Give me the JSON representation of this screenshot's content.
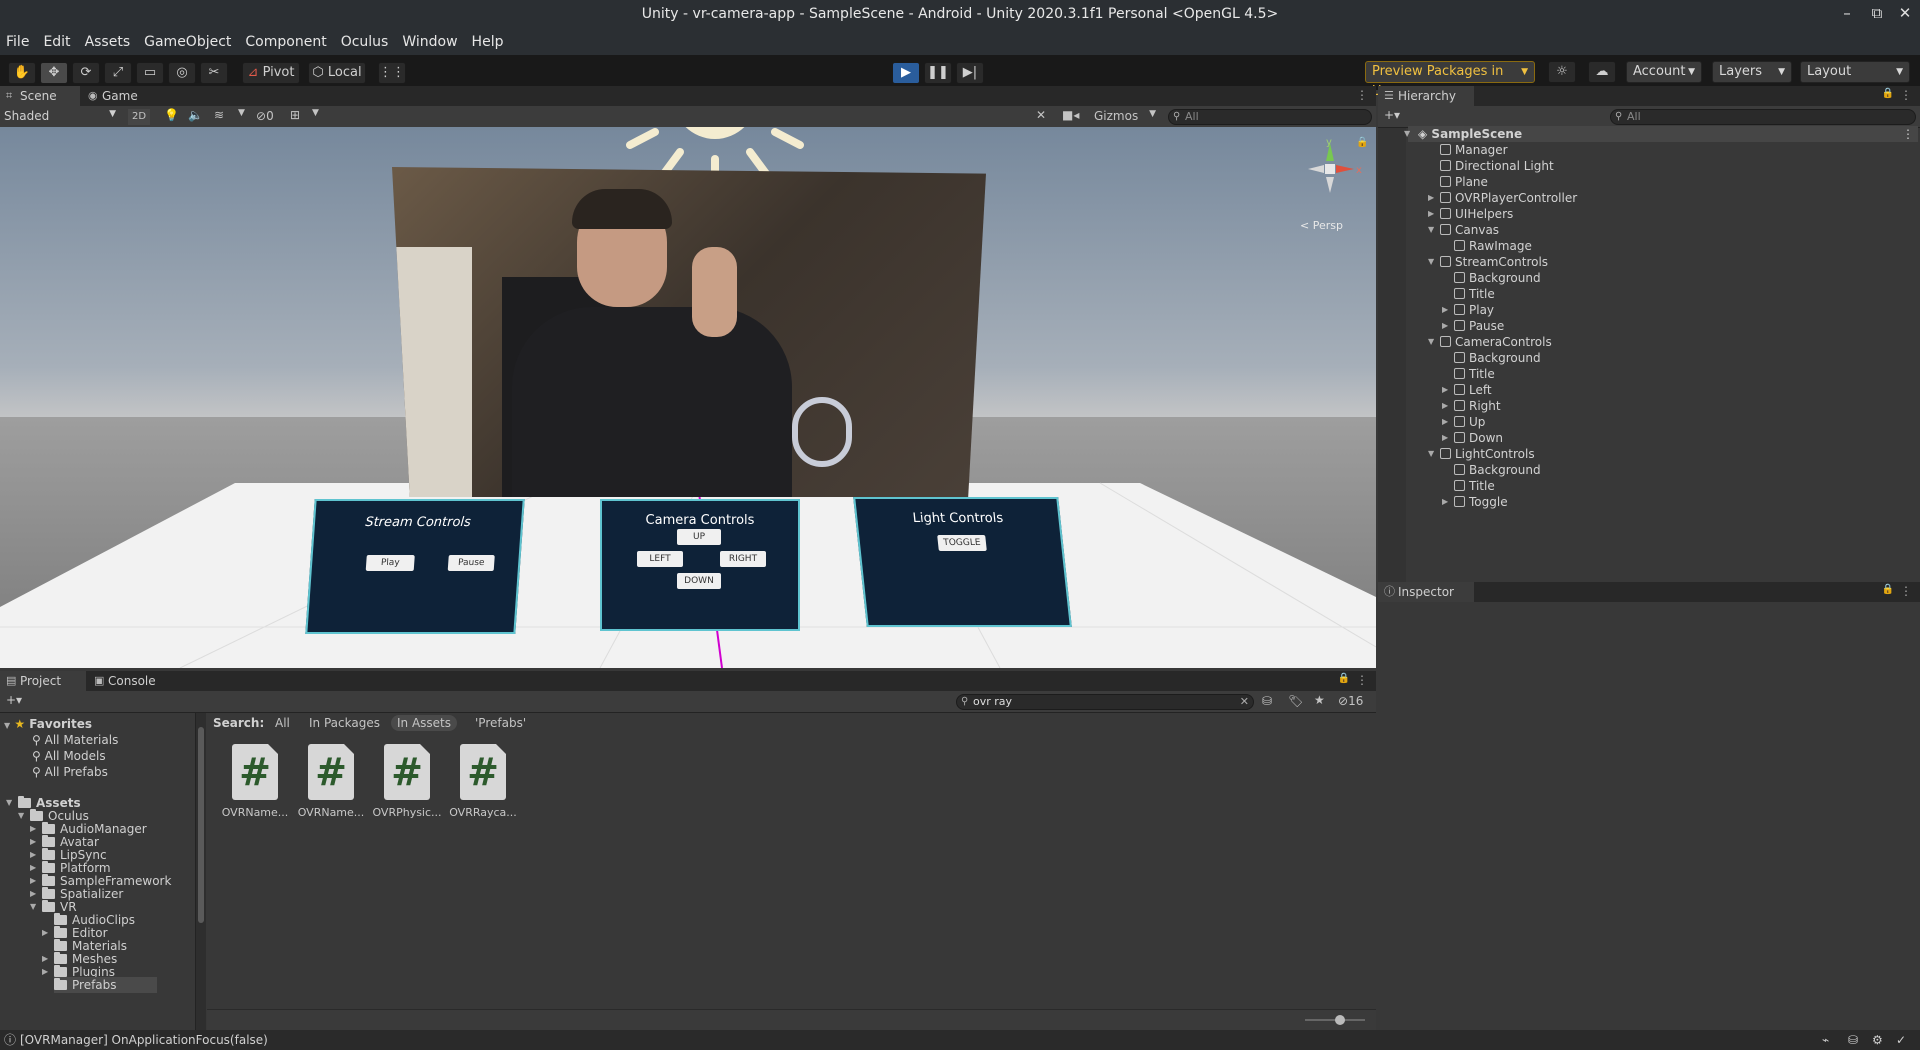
{
  "window": {
    "title": "Unity - vr-camera-app - SampleScene - Android - Unity 2020.3.1f1 Personal <OpenGL 4.5>"
  },
  "menu": [
    "File",
    "Edit",
    "Assets",
    "GameObject",
    "Component",
    "Oculus",
    "Window",
    "Help"
  ],
  "toolbar": {
    "pivot": "Pivot",
    "local": "Local",
    "preview_packages": "Preview Packages in Use",
    "account": "Account",
    "layers": "Layers",
    "layout": "Layout",
    "accent": "#2a5d9c"
  },
  "scene_view": {
    "tabs": [
      "Scene",
      "Game"
    ],
    "shading": "Shaded",
    "mode_2d": "2D",
    "hidden_count": "0",
    "gizmos": "Gizmos",
    "search_placeholder": "All",
    "persp": "< Persp",
    "axis_y": "y",
    "axis_x": "x",
    "panels": {
      "stream": {
        "title": "Stream Controls",
        "play": "Play",
        "pause": "Pause"
      },
      "camera": {
        "title": "Camera Controls",
        "up": "UP",
        "left": "LEFT",
        "right": "RIGHT",
        "down": "DOWN"
      },
      "light": {
        "title": "Light Controls",
        "toggle": "TOGGLE"
      }
    }
  },
  "hierarchy": {
    "title": "Hierarchy",
    "search_placeholder": "All",
    "scene": "SampleScene",
    "items": [
      {
        "label": "Manager",
        "depth": 1,
        "arrow": ""
      },
      {
        "label": "Directional Light",
        "depth": 1,
        "arrow": ""
      },
      {
        "label": "Plane",
        "depth": 1,
        "arrow": ""
      },
      {
        "label": "OVRPlayerController",
        "depth": 1,
        "arrow": "right"
      },
      {
        "label": "UIHelpers",
        "depth": 1,
        "arrow": "right"
      },
      {
        "label": "Canvas",
        "depth": 1,
        "arrow": "down"
      },
      {
        "label": "RawImage",
        "depth": 2,
        "arrow": ""
      },
      {
        "label": "StreamControls",
        "depth": 1,
        "arrow": "down"
      },
      {
        "label": "Background",
        "depth": 2,
        "arrow": ""
      },
      {
        "label": "Title",
        "depth": 2,
        "arrow": ""
      },
      {
        "label": "Play",
        "depth": 2,
        "arrow": "right"
      },
      {
        "label": "Pause",
        "depth": 2,
        "arrow": "right"
      },
      {
        "label": "CameraControls",
        "depth": 1,
        "arrow": "down"
      },
      {
        "label": "Background",
        "depth": 2,
        "arrow": ""
      },
      {
        "label": "Title",
        "depth": 2,
        "arrow": ""
      },
      {
        "label": "Left",
        "depth": 2,
        "arrow": "right"
      },
      {
        "label": "Right",
        "depth": 2,
        "arrow": "right"
      },
      {
        "label": "Up",
        "depth": 2,
        "arrow": "right"
      },
      {
        "label": "Down",
        "depth": 2,
        "arrow": "right"
      },
      {
        "label": "LightControls",
        "depth": 1,
        "arrow": "down"
      },
      {
        "label": "Background",
        "depth": 2,
        "arrow": ""
      },
      {
        "label": "Title",
        "depth": 2,
        "arrow": ""
      },
      {
        "label": "Toggle",
        "depth": 2,
        "arrow": "right"
      }
    ]
  },
  "inspector": {
    "title": "Inspector"
  },
  "project": {
    "tabs": [
      "Project",
      "Console"
    ],
    "search_value": "ovr ray",
    "hidden_count": "16",
    "search_label": "Search:",
    "filters": [
      "All",
      "In Packages",
      "In Assets",
      "'Prefabs'"
    ],
    "favorites": {
      "title": "Favorites",
      "items": [
        "All Materials",
        "All Models",
        "All Prefabs"
      ]
    },
    "assets_tree": [
      {
        "label": "Assets",
        "depth": 0,
        "arrow": "down",
        "bold": true
      },
      {
        "label": "Oculus",
        "depth": 1,
        "arrow": "down"
      },
      {
        "label": "AudioManager",
        "depth": 2,
        "arrow": "right"
      },
      {
        "label": "Avatar",
        "depth": 2,
        "arrow": "right"
      },
      {
        "label": "LipSync",
        "depth": 2,
        "arrow": "right"
      },
      {
        "label": "Platform",
        "depth": 2,
        "arrow": "right"
      },
      {
        "label": "SampleFramework",
        "depth": 2,
        "arrow": "right"
      },
      {
        "label": "Spatializer",
        "depth": 2,
        "arrow": "right"
      },
      {
        "label": "VR",
        "depth": 2,
        "arrow": "down"
      },
      {
        "label": "AudioClips",
        "depth": 3,
        "arrow": ""
      },
      {
        "label": "Editor",
        "depth": 3,
        "arrow": "right"
      },
      {
        "label": "Materials",
        "depth": 3,
        "arrow": ""
      },
      {
        "label": "Meshes",
        "depth": 3,
        "arrow": "right"
      },
      {
        "label": "Plugins",
        "depth": 3,
        "arrow": "right"
      },
      {
        "label": "Prefabs",
        "depth": 3,
        "arrow": ""
      }
    ],
    "assets": [
      "OVRName...",
      "OVRName...",
      "OVRPhysic...",
      "OVRRayca..."
    ],
    "asset_glyph": "#"
  },
  "status": {
    "message": "[OVRManager] OnApplicationFocus(false)"
  }
}
